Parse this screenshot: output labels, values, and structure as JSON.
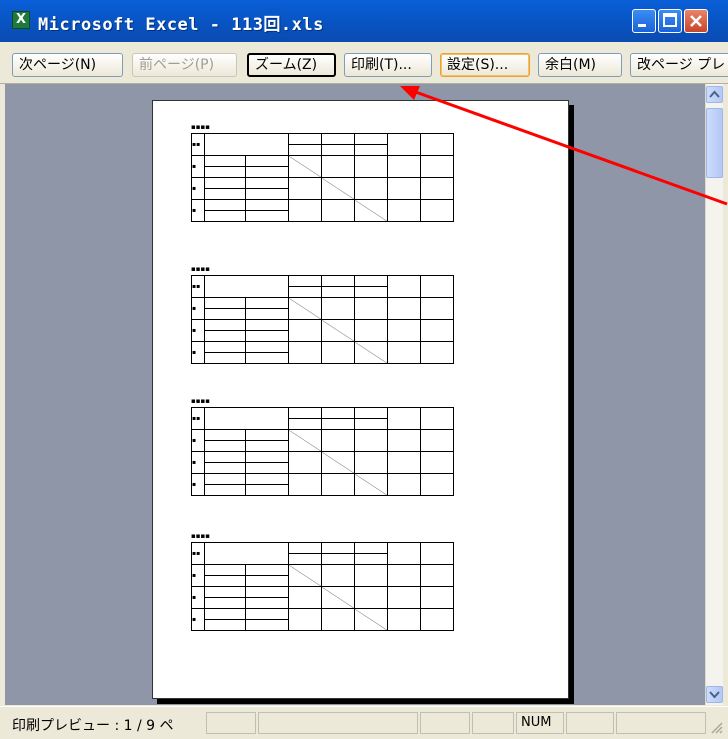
{
  "window": {
    "title": "Microsoft Excel - 113回.xls"
  },
  "toolbar": {
    "next_page": "次ページ(N)",
    "prev_page": "前ページ(P)",
    "zoom": "ズーム(Z)",
    "print": "印刷(T)...",
    "setup": "設定(S)...",
    "margins": "余白(M)",
    "page_break": "改ページ プレ"
  },
  "status": {
    "text": "印刷プレビュー : 1 / 9 ペ",
    "num": "NUM"
  },
  "icons": [
    "excel-icon",
    "minimize-icon",
    "maximize-icon",
    "close-icon",
    "scroll-up-icon",
    "scroll-down-icon",
    "resize-grip-icon"
  ],
  "annotation": {
    "arrow_color": "#ff0000"
  }
}
